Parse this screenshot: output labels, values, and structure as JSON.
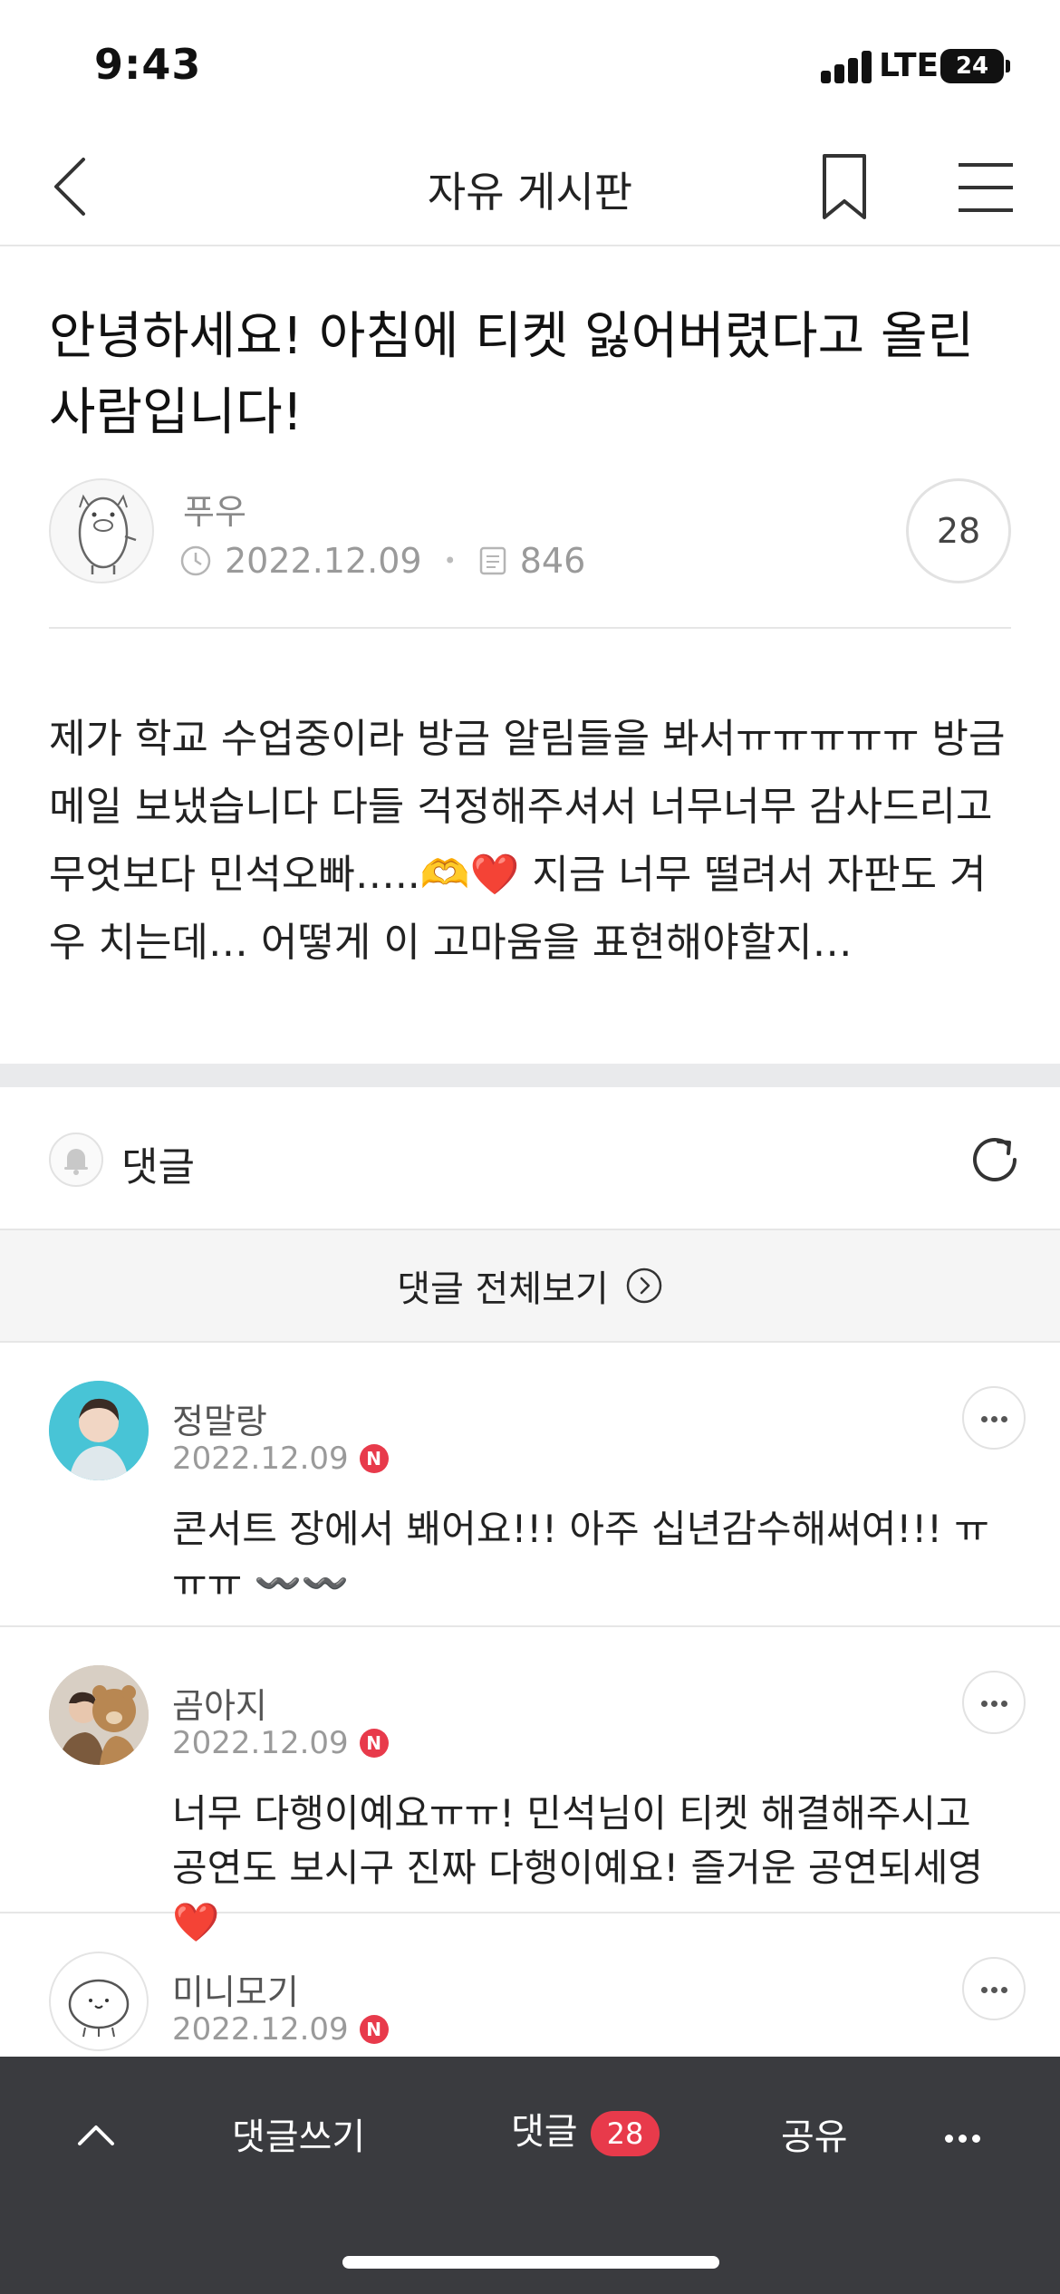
{
  "status_bar": {
    "time": "9:43",
    "network": "LTE",
    "battery": "24"
  },
  "nav": {
    "title": "자유 게시판"
  },
  "post": {
    "title": "안녕하세요! 아침에 티켓 잃어버렸다고 올린 사람입니다!",
    "author": "푸우",
    "date": "2022.12.09",
    "views": "846",
    "comment_count": "28",
    "body": "제가 학교 수업중이라 방금 알림들을 봐서ㅠㅠㅠㅠㅠ 방금 메일 보냈습니다 다들 걱정해주셔서 너무너무 감사드리고 무엇보다 민석오빠…..🫶❤️ 지금 너무 떨려서 자판도 겨우 치는데… 어떻게 이 고마움을 표현해야할지…"
  },
  "comments_section": {
    "label": "댓글",
    "view_all": "댓글 전체보기"
  },
  "comments": [
    {
      "name": "정말랑",
      "date": "2022.12.09",
      "badge": "N",
      "text": "콘서트 장에서 봬어요!!! 아주 십년감수해써여!!! ㅠㅠㅠ 〰️〰️"
    },
    {
      "name": "곰아지",
      "date": "2022.12.09",
      "badge": "N",
      "text": "너무 다행이예요ㅠㅠ! 민석님이 티켓 해결해주시고 공연도 보시구 진짜 다행이예요! 즐거운 공연되세영❤️"
    },
    {
      "name": "미니모기",
      "date": "2022.12.09",
      "badge": "N",
      "text": ""
    }
  ],
  "bottom_bar": {
    "write": "댓글쓰기",
    "comments": "댓글",
    "comments_count": "28",
    "share": "공유"
  },
  "colors": {
    "accent": "#e83a4b",
    "bottom_bar": "#3a3b3f",
    "divider": "#e6e6e6"
  }
}
